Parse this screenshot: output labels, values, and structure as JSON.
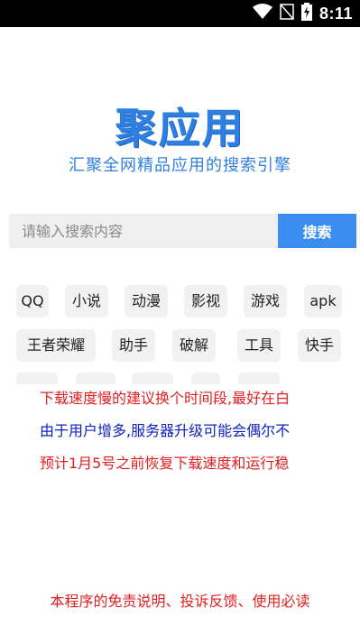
{
  "status_bar": {
    "time": "8:11",
    "icons": [
      "wifi-icon",
      "no-signal-icon",
      "battery-charging-icon"
    ]
  },
  "app": {
    "logo_text": "聚应用",
    "slogan": "汇聚全网精品应用的搜索引擎",
    "brand_color": "#2f7fe0"
  },
  "search": {
    "placeholder": "请输入搜索内容",
    "value": "",
    "button_label": "搜索"
  },
  "tags": [
    "QQ",
    "小说",
    "动漫",
    "影视",
    "游戏",
    "apk",
    "王者荣耀",
    "助手",
    "破解",
    "工具",
    "快手"
  ],
  "notices": [
    {
      "text": "下载速度慢的建议换个时间段,最好在白",
      "color": "red"
    },
    {
      "text": "由于用户增多,服务器升级可能会偶尔不",
      "color": "blue"
    },
    {
      "text": "预计1月5号之前恢复下载速度和运行稳",
      "color": "red"
    }
  ],
  "footer": {
    "link_text": "本程序的免责说明、投诉反馈、使用必读"
  }
}
